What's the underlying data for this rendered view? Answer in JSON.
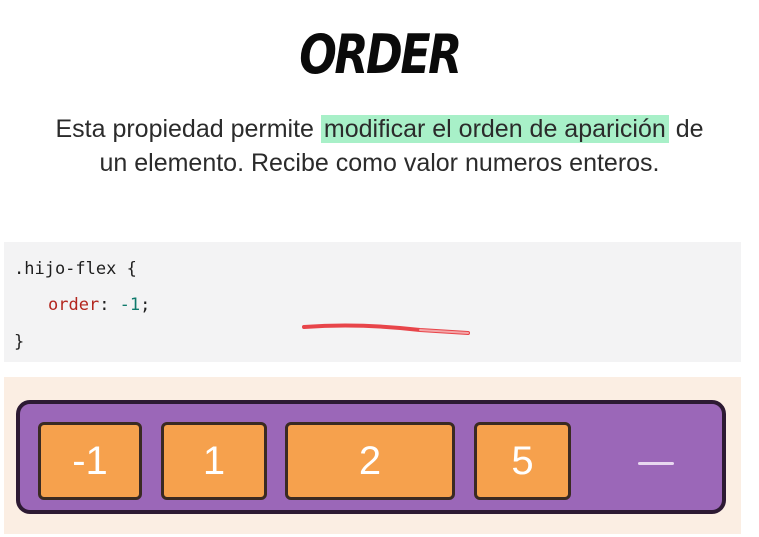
{
  "title": "ORDER",
  "description": {
    "before": "Esta propiedad permite ",
    "highlight": "modificar el orden de aparición",
    "after_line1": " de",
    "line2": "un elemento. Recibe como valor numeros enteros."
  },
  "code": {
    "selector": ".hijo-flex",
    "open_brace": " {",
    "property": "order",
    "colon": ": ",
    "value": "-1",
    "semicolon": ";",
    "close_brace": "}"
  },
  "flex_demo": {
    "items": [
      {
        "label": "-1"
      },
      {
        "label": "1"
      },
      {
        "label": "2"
      },
      {
        "label": "5"
      }
    ],
    "container_color": "#9b67b8",
    "item_color": "#f6a14d",
    "panel_color": "#fbeee3"
  },
  "colors": {
    "highlight": "#a8f0c8",
    "code_background": "#f3f3f4",
    "property_color": "#b3261e",
    "number_color": "#0f7a6c"
  }
}
